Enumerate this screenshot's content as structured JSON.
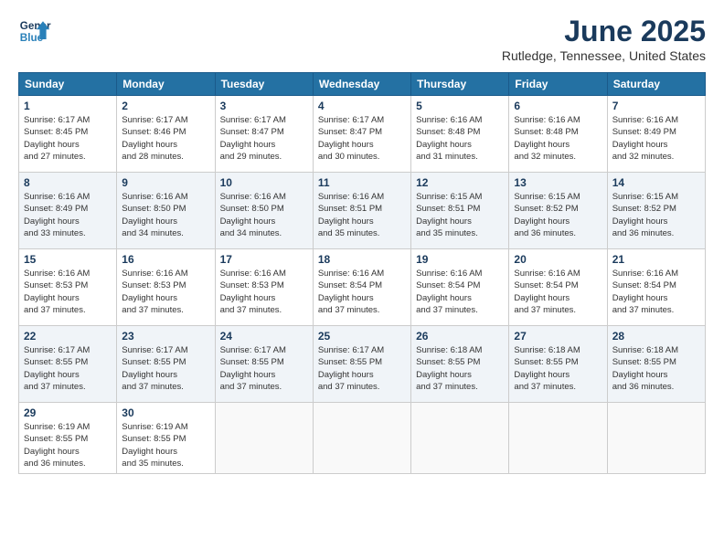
{
  "logo": {
    "line1": "General",
    "line2": "Blue"
  },
  "title": "June 2025",
  "location": "Rutledge, Tennessee, United States",
  "weekdays": [
    "Sunday",
    "Monday",
    "Tuesday",
    "Wednesday",
    "Thursday",
    "Friday",
    "Saturday"
  ],
  "weeks": [
    [
      {
        "day": "1",
        "rise": "6:17 AM",
        "set": "8:45 PM",
        "hours": "14 hours and 27 minutes."
      },
      {
        "day": "2",
        "rise": "6:17 AM",
        "set": "8:46 PM",
        "hours": "14 hours and 28 minutes."
      },
      {
        "day": "3",
        "rise": "6:17 AM",
        "set": "8:47 PM",
        "hours": "14 hours and 29 minutes."
      },
      {
        "day": "4",
        "rise": "6:17 AM",
        "set": "8:47 PM",
        "hours": "14 hours and 30 minutes."
      },
      {
        "day": "5",
        "rise": "6:16 AM",
        "set": "8:48 PM",
        "hours": "14 hours and 31 minutes."
      },
      {
        "day": "6",
        "rise": "6:16 AM",
        "set": "8:48 PM",
        "hours": "14 hours and 32 minutes."
      },
      {
        "day": "7",
        "rise": "6:16 AM",
        "set": "8:49 PM",
        "hours": "14 hours and 32 minutes."
      }
    ],
    [
      {
        "day": "8",
        "rise": "6:16 AM",
        "set": "8:49 PM",
        "hours": "14 hours and 33 minutes."
      },
      {
        "day": "9",
        "rise": "6:16 AM",
        "set": "8:50 PM",
        "hours": "14 hours and 34 minutes."
      },
      {
        "day": "10",
        "rise": "6:16 AM",
        "set": "8:50 PM",
        "hours": "14 hours and 34 minutes."
      },
      {
        "day": "11",
        "rise": "6:16 AM",
        "set": "8:51 PM",
        "hours": "14 hours and 35 minutes."
      },
      {
        "day": "12",
        "rise": "6:15 AM",
        "set": "8:51 PM",
        "hours": "14 hours and 35 minutes."
      },
      {
        "day": "13",
        "rise": "6:15 AM",
        "set": "8:52 PM",
        "hours": "14 hours and 36 minutes."
      },
      {
        "day": "14",
        "rise": "6:15 AM",
        "set": "8:52 PM",
        "hours": "14 hours and 36 minutes."
      }
    ],
    [
      {
        "day": "15",
        "rise": "6:16 AM",
        "set": "8:53 PM",
        "hours": "14 hours and 37 minutes."
      },
      {
        "day": "16",
        "rise": "6:16 AM",
        "set": "8:53 PM",
        "hours": "14 hours and 37 minutes."
      },
      {
        "day": "17",
        "rise": "6:16 AM",
        "set": "8:53 PM",
        "hours": "14 hours and 37 minutes."
      },
      {
        "day": "18",
        "rise": "6:16 AM",
        "set": "8:54 PM",
        "hours": "14 hours and 37 minutes."
      },
      {
        "day": "19",
        "rise": "6:16 AM",
        "set": "8:54 PM",
        "hours": "14 hours and 37 minutes."
      },
      {
        "day": "20",
        "rise": "6:16 AM",
        "set": "8:54 PM",
        "hours": "14 hours and 37 minutes."
      },
      {
        "day": "21",
        "rise": "6:16 AM",
        "set": "8:54 PM",
        "hours": "14 hours and 37 minutes."
      }
    ],
    [
      {
        "day": "22",
        "rise": "6:17 AM",
        "set": "8:55 PM",
        "hours": "14 hours and 37 minutes."
      },
      {
        "day": "23",
        "rise": "6:17 AM",
        "set": "8:55 PM",
        "hours": "14 hours and 37 minutes."
      },
      {
        "day": "24",
        "rise": "6:17 AM",
        "set": "8:55 PM",
        "hours": "14 hours and 37 minutes."
      },
      {
        "day": "25",
        "rise": "6:17 AM",
        "set": "8:55 PM",
        "hours": "14 hours and 37 minutes."
      },
      {
        "day": "26",
        "rise": "6:18 AM",
        "set": "8:55 PM",
        "hours": "14 hours and 37 minutes."
      },
      {
        "day": "27",
        "rise": "6:18 AM",
        "set": "8:55 PM",
        "hours": "14 hours and 37 minutes."
      },
      {
        "day": "28",
        "rise": "6:18 AM",
        "set": "8:55 PM",
        "hours": "14 hours and 36 minutes."
      }
    ],
    [
      {
        "day": "29",
        "rise": "6:19 AM",
        "set": "8:55 PM",
        "hours": "14 hours and 36 minutes."
      },
      {
        "day": "30",
        "rise": "6:19 AM",
        "set": "8:55 PM",
        "hours": "14 hours and 35 minutes."
      },
      null,
      null,
      null,
      null,
      null
    ]
  ]
}
